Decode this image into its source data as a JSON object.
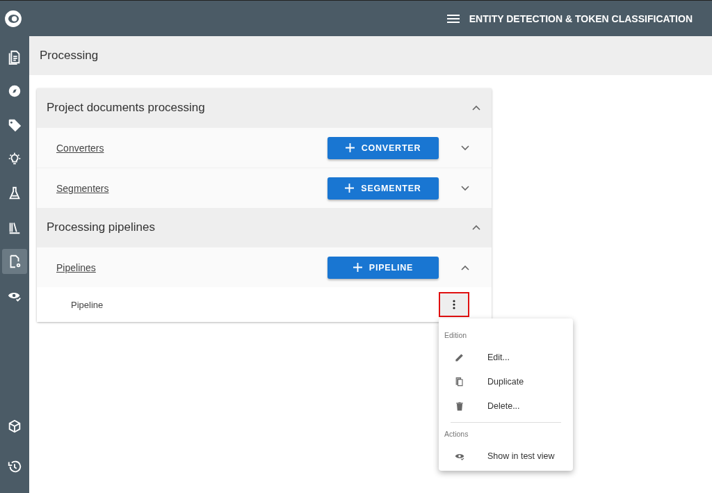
{
  "app_bar": {
    "title": "ENTITY DETECTION & TOKEN CLASSIFICATION"
  },
  "sidebar": {
    "items": [
      {
        "selected": false
      },
      {
        "selected": false
      },
      {
        "selected": false
      },
      {
        "selected": false
      },
      {
        "selected": false
      },
      {
        "selected": false
      },
      {
        "selected": true
      },
      {
        "selected": false
      }
    ],
    "bottom_items": [
      {
        "selected": false
      },
      {
        "selected": false
      }
    ]
  },
  "page_title": "Processing",
  "sections": [
    {
      "title": "Project documents processing",
      "expanded": true,
      "groups": [
        {
          "label": "Converters",
          "button": "CONVERTER",
          "expanded": false
        },
        {
          "label": "Segmenters",
          "button": "SEGMENTER",
          "expanded": false
        }
      ]
    },
    {
      "title": "Processing pipelines",
      "expanded": true,
      "groups": [
        {
          "label": "Pipelines",
          "button": "PIPELINE",
          "expanded": true,
          "items": [
            {
              "name": "Pipeline",
              "highlighted": true
            }
          ]
        }
      ]
    }
  ],
  "menu": {
    "groups": [
      {
        "header": "Edition",
        "items": [
          "Edit...",
          "Duplicate",
          "Delete..."
        ]
      },
      {
        "header": "Actions",
        "items": [
          "Show in test view"
        ]
      }
    ]
  }
}
